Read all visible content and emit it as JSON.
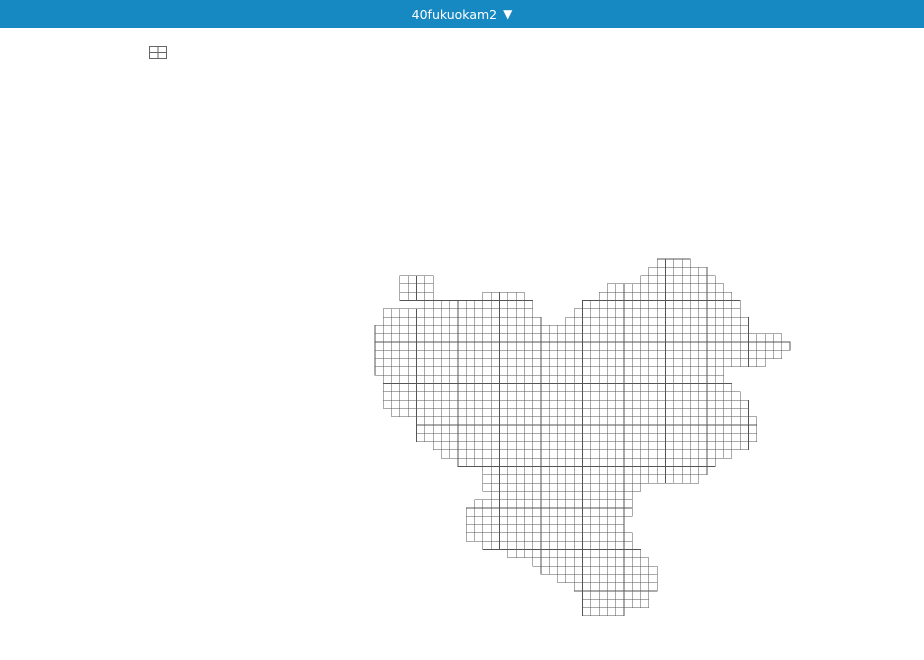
{
  "header": {
    "title": "40fukuokam2",
    "caret_symbol": "▼",
    "background_color": "#1688c2",
    "text_color": "#ffffff"
  },
  "toolbar": {
    "grid_toggle_icon": "grid-table-icon"
  },
  "map": {
    "cell_fill": "#ffffff",
    "cell_stroke": "#555555"
  }
}
